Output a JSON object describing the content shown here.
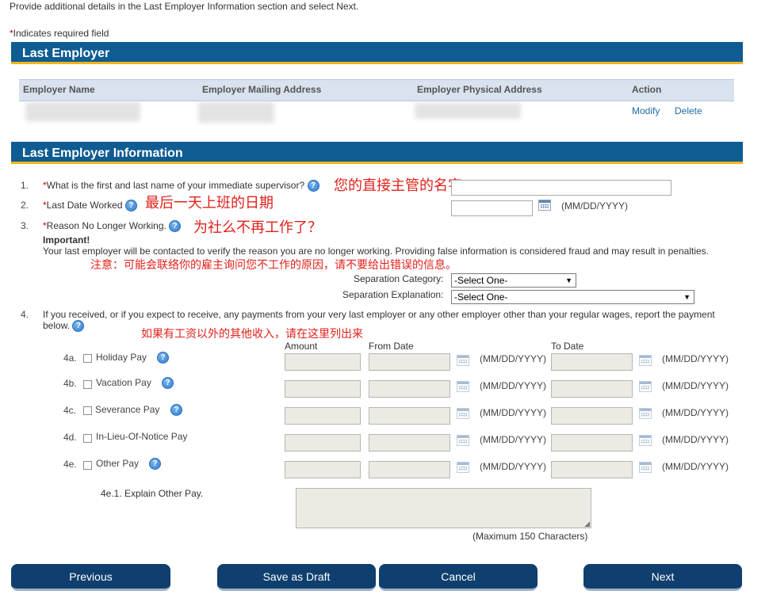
{
  "intro": "Provide additional details in the Last Employer Information section and select Next.",
  "required_note": {
    "asterisk": "*",
    "text": "Indicates required field"
  },
  "last_employer": {
    "title": "Last Employer",
    "columns": [
      "Employer Name",
      "Employer Mailing Address",
      "Employer Physical Address",
      "Action"
    ],
    "actions": {
      "modify": "Modify",
      "delete": "Delete"
    }
  },
  "info": {
    "title": "Last Employer Information",
    "q1": {
      "num": "1.",
      "asterisk": "*",
      "text": "What is the first and last name of your immediate supervisor?",
      "annotation": "您的直接主管的名字",
      "value": ""
    },
    "q2": {
      "num": "2.",
      "asterisk": "*",
      "text": "Last Date Worked",
      "annotation": "最后一天上班的日期",
      "value": "",
      "format": "(MM/DD/YYYY)"
    },
    "q3": {
      "num": "3.",
      "asterisk": "*",
      "text": "Reason No Longer Working.",
      "annotation": "为社么不再工作了？",
      "important_label": "Important!",
      "important_text": "Your last employer will be contacted to verify the reason you are no longer working. Providing false information is considered fraud and may result in penalties.",
      "important_annotation": "注意：可能会联络你的雇主询问您不工作的原因，请不要给出错误的信息。",
      "category_label": "Separation Category:",
      "category_value": "-Select One-",
      "explanation_label": "Separation Explanation:",
      "explanation_value": "-Select One-"
    },
    "q4": {
      "num": "4.",
      "text": "If you received, or if you expect to receive, any payments from your very last employer or any other employer other than your regular wages, report the payment below.",
      "annotation": "如果有工资以外的其他收入，请在这里列出来",
      "headers": {
        "amount": "Amount",
        "from": "From Date",
        "to": "To Date"
      },
      "date_format": "(MM/DD/YYYY)",
      "rows": [
        {
          "code": "4a.",
          "label": "Holiday Pay"
        },
        {
          "code": "4b.",
          "label": "Vacation Pay"
        },
        {
          "code": "4c.",
          "label": "Severance Pay"
        },
        {
          "code": "4d.",
          "label": "In-Lieu-Of-Notice Pay"
        },
        {
          "code": "4e.",
          "label": "Other Pay"
        }
      ],
      "explain_label": "4e.1. Explain Other Pay.",
      "max_note": "(Maximum 150 Characters)"
    }
  },
  "buttons": {
    "previous": "Previous",
    "save_draft": "Save as Draft",
    "cancel": "Cancel",
    "next": "Next"
  },
  "colors": {
    "header_bar": "#0e5c91",
    "accent_stripe": "#f0b41e",
    "button": "#0f3f6e",
    "annotation": "#e0211b",
    "required": "#cc0000"
  }
}
